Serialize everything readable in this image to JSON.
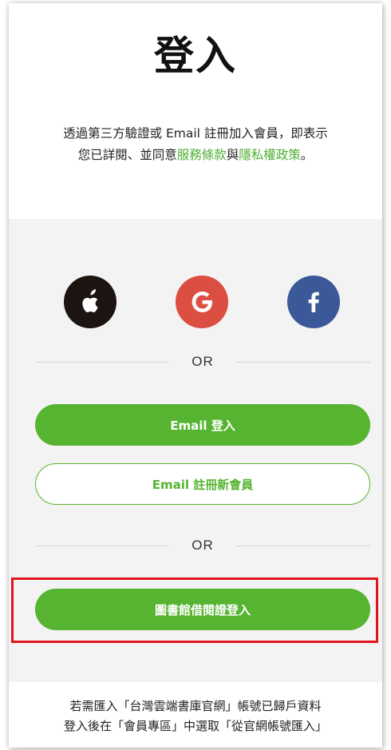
{
  "title": "登入",
  "terms": {
    "line1": "透過第三方驗證或 Email 註冊加入會員，即表示",
    "line2_prefix": "您已詳閱、並同意",
    "terms_link": "服務條款",
    "and": "與",
    "privacy_link": "隱私權政策",
    "line2_suffix": "。"
  },
  "social": [
    {
      "name": "apple",
      "icon": "apple-icon",
      "color": "#1b1410"
    },
    {
      "name": "google",
      "icon": "google-icon",
      "color": "#dc4e41"
    },
    {
      "name": "facebook",
      "icon": "facebook-icon",
      "color": "#3b5998"
    }
  ],
  "divider_text": "OR",
  "buttons": {
    "email_login": "Email 登入",
    "email_register": "Email 註冊新會員",
    "library_login": "圖書館借閱證登入"
  },
  "footer": {
    "line1": "若需匯入「台灣雲端書庫官網」帳號已歸戶資料",
    "line2": "登入後在「會員專區」中選取「從官網帳號匯入」"
  },
  "colors": {
    "accent": "#56b431",
    "link": "#4dae2f",
    "highlight": "#e0161b",
    "panel_bg": "#f3f3f3"
  }
}
